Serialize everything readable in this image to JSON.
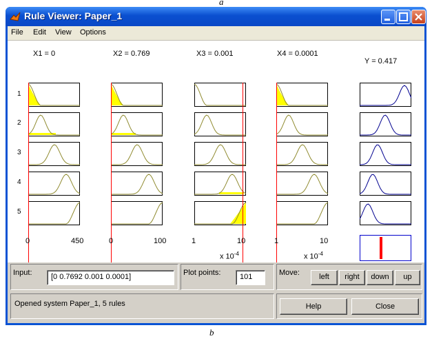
{
  "caption_top": "a",
  "caption_bottom": "b",
  "window": {
    "title": "Rule Viewer: Paper_1"
  },
  "menu": [
    "File",
    "Edit",
    "View",
    "Options"
  ],
  "inputs": [
    {
      "label": "X1 = 0",
      "range_min": "0",
      "range_max": "450",
      "scale_base": "",
      "scale_exp": ""
    },
    {
      "label": "X2 = 0.769",
      "range_min": "0",
      "range_max": "100",
      "scale_base": "",
      "scale_exp": ""
    },
    {
      "label": "X3 = 0.001",
      "range_min": "1",
      "range_max": "10",
      "scale_base": "x 10",
      "scale_exp": "-4"
    },
    {
      "label": "X4 = 0.0001",
      "range_min": "1",
      "range_max": "10",
      "scale_base": "x 10",
      "scale_exp": "-4"
    }
  ],
  "output": {
    "label": "Y = 0.417",
    "range_min": "0",
    "range_max": "1",
    "value_fraction": 0.417
  },
  "rules": [
    "1",
    "2",
    "3",
    "4",
    "5"
  ],
  "controls": {
    "input_label": "Input:",
    "input_value": "[0 0.7692 0.001 0.0001]",
    "plot_points_label": "Plot points:",
    "plot_points_value": "101",
    "move_label": "Move:",
    "left": "left",
    "right": "right",
    "down": "down",
    "up": "up",
    "help": "Help",
    "close": "Close",
    "status": "Opened system Paper_1, 5 rules"
  },
  "colors": {
    "mf_line": "#8f8a2e",
    "fill": "#ffff00",
    "output_line": "#00008f",
    "rule_line": "#ff0000"
  }
}
